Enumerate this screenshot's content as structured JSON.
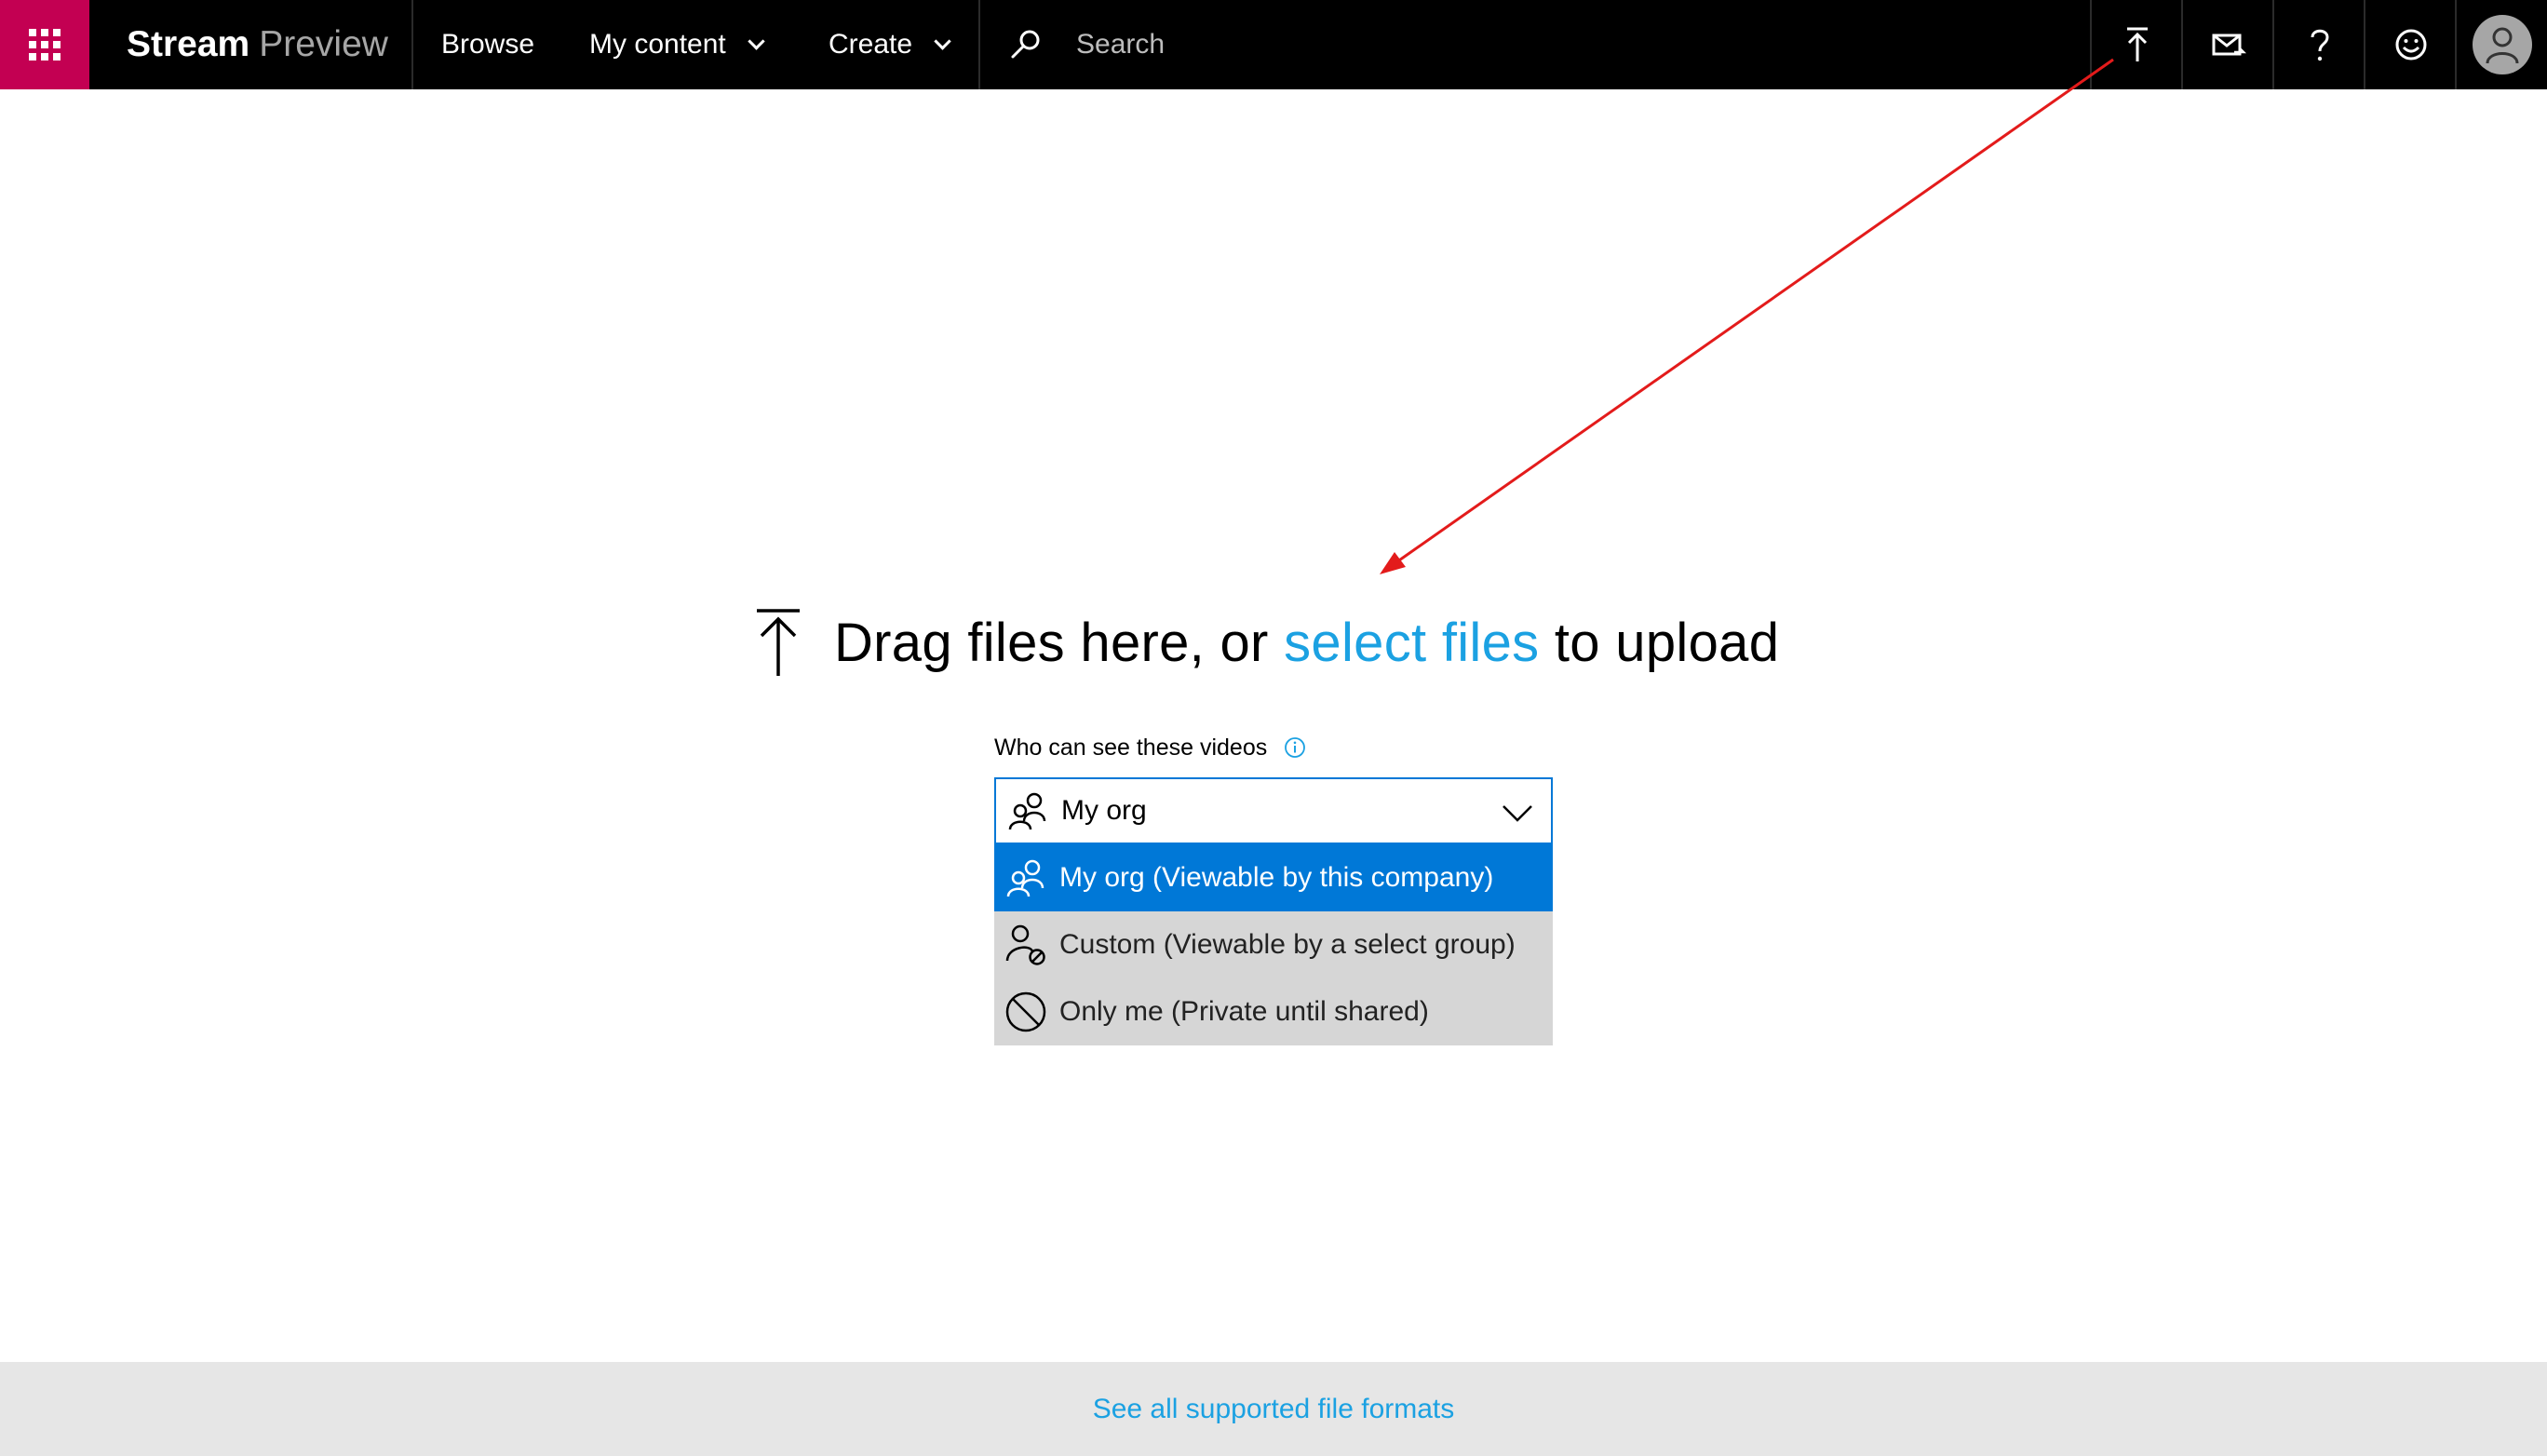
{
  "header": {
    "brand_primary": "Stream",
    "brand_secondary": "Preview",
    "nav": {
      "browse": "Browse",
      "my_content": "My content",
      "create": "Create"
    },
    "search_placeholder": "Search",
    "tools": [
      "upload-icon",
      "mail-icon",
      "help-icon",
      "feedback-icon",
      "avatar-icon"
    ]
  },
  "upload": {
    "prefix": "Drag files here, or",
    "link": "select files",
    "suffix": "to upload"
  },
  "visibility": {
    "label": "Who can see these videos",
    "selected": "My org",
    "options": [
      {
        "label": "My org (Viewable by this company)",
        "icon": "people-icon"
      },
      {
        "label": "Custom (Viewable by a select group)",
        "icon": "person-block-icon"
      },
      {
        "label": "Only me (Private until shared)",
        "icon": "block-icon"
      }
    ]
  },
  "footer": {
    "link": "See all supported file formats"
  },
  "colors": {
    "waffle_bg": "#c30052",
    "accent_blue": "#0078d7",
    "link_blue": "#1ba1e2",
    "annotation_red": "#e31b1b"
  }
}
